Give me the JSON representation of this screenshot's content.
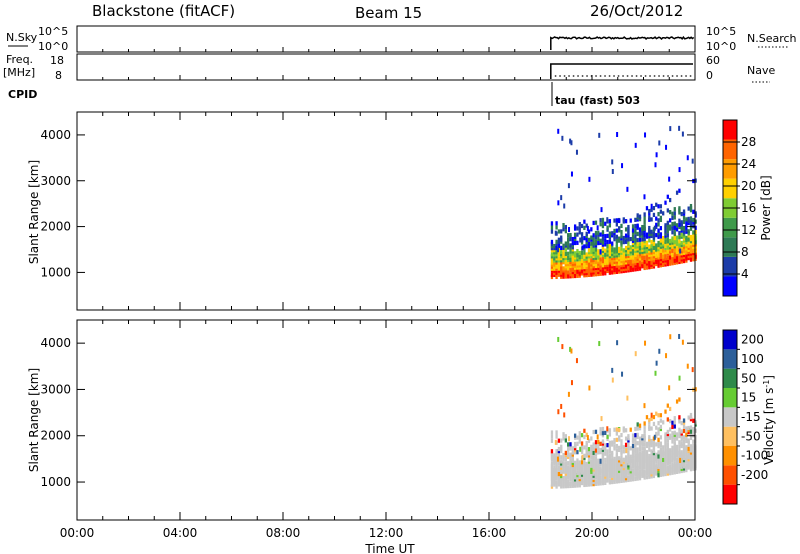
{
  "header": {
    "station": "Blackstone (fitACF)",
    "beam": "Beam 15",
    "date": "26/Oct/2012"
  },
  "top_panels": {
    "nsky": {
      "label": "N.Sky",
      "ticks": [
        "10^5",
        "10^0"
      ]
    },
    "nsearch": {
      "label": "N.Search",
      "ticks": [
        "10^5",
        "10^0"
      ]
    },
    "freq": {
      "label_1": "Freq.",
      "label_2": "[MHz]",
      "ticks": [
        "18",
        "8"
      ]
    },
    "nave": {
      "label": "Nave",
      "ticks": [
        "60",
        "0"
      ]
    },
    "cpid": {
      "label": "CPID",
      "value": "tau (fast) 503"
    }
  },
  "colors": {
    "power": [
      "#0000ff",
      "#1c3ca8",
      "#2e7a55",
      "#3f9a4a",
      "#7fcc33",
      "#ffd000",
      "#ff9c00",
      "#ff6400",
      "#ff0000"
    ],
    "velocity": [
      "#ff0000",
      "#ff5000",
      "#ff9000",
      "#ffc060",
      "#c8c8c8",
      "#66cc33",
      "#2e8a4a",
      "#2c5f9a",
      "#0000cc"
    ],
    "grey": "#c8c8c8"
  },
  "chart_data": [
    {
      "type": "heatmap",
      "name": "power",
      "xlabel": "",
      "ylabel": "Slant Range [km]",
      "x_ticks": [
        "00:00",
        "04:00",
        "08:00",
        "12:00",
        "16:00",
        "20:00",
        "00:00"
      ],
      "x_hours": [
        0,
        4,
        8,
        12,
        16,
        20,
        24
      ],
      "y_ticks": [
        1000,
        2000,
        3000,
        4000
      ],
      "xlim": [
        0,
        24
      ],
      "ylim": [
        180,
        4500
      ],
      "colorbar": {
        "label": "Power [dB]",
        "ticks": [
          4,
          8,
          12,
          16,
          20,
          24,
          28
        ],
        "range": [
          0,
          32
        ]
      },
      "data_start_hour": 18.4,
      "data_end_hour": 24
    },
    {
      "type": "heatmap",
      "name": "velocity",
      "xlabel": "Time UT",
      "ylabel": "Slant Range [km]",
      "x_ticks": [
        "00:00",
        "04:00",
        "08:00",
        "12:00",
        "16:00",
        "20:00",
        "00:00"
      ],
      "x_hours": [
        0,
        4,
        8,
        12,
        16,
        20,
        24
      ],
      "y_ticks": [
        1000,
        2000,
        3000,
        4000
      ],
      "xlim": [
        0,
        24
      ],
      "ylim": [
        180,
        4500
      ],
      "colorbar": {
        "label": "Velocity [m s-1]",
        "ticks": [
          200,
          100,
          50,
          15,
          -15,
          -50,
          -100,
          -200
        ]
      },
      "data_start_hour": 18.4,
      "data_end_hour": 24
    }
  ]
}
